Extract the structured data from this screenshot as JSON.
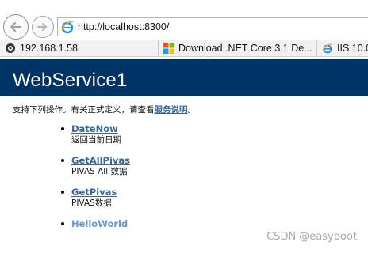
{
  "browser": {
    "address": "http://localhost:8300/",
    "favorites": [
      {
        "label": "192.168.1.58",
        "icon": "globe-icon"
      },
      {
        "label": "Download .NET Core 3.1 De...",
        "icon": "microsoft-logo-icon"
      },
      {
        "label": "IIS 10.0",
        "icon": "ie-icon"
      }
    ]
  },
  "page": {
    "title": "WebService1",
    "intro_text": "支持下列操作。有关正式定义，请查看",
    "intro_link": "服务说明",
    "intro_end": "。",
    "operations": [
      {
        "name": "DateNow",
        "description": "返回当前日期"
      },
      {
        "name": "GetAllPivas",
        "description": "PIVAS All 数据"
      },
      {
        "name": "GetPivas",
        "description": "PIVAS数据"
      },
      {
        "name": "HelloWorld",
        "description": ""
      }
    ]
  },
  "watermark": "CSDN @easyboot",
  "colors": {
    "banner": "#003366",
    "link": "#336699"
  }
}
